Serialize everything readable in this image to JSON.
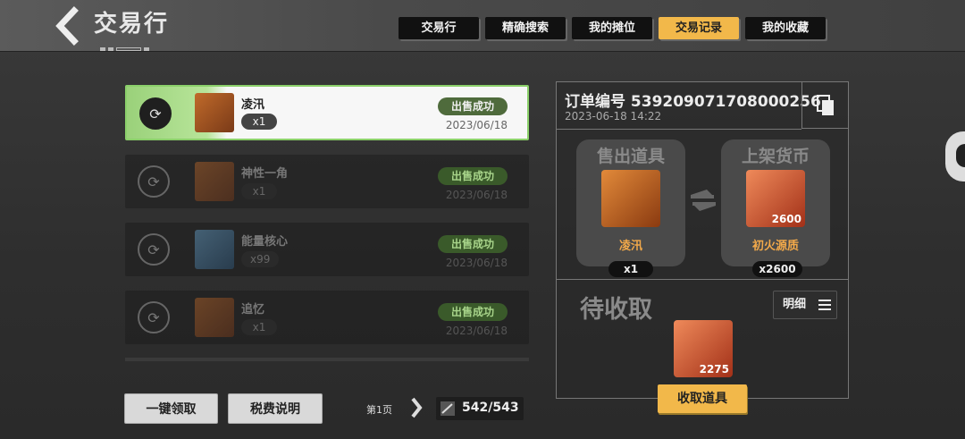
{
  "header": {
    "title": "交易行",
    "back_icon": "chevron-left-icon"
  },
  "tabs": [
    {
      "label": "交易行",
      "active": false
    },
    {
      "label": "精确搜索",
      "active": false
    },
    {
      "label": "我的摊位",
      "active": false
    },
    {
      "label": "交易记录",
      "active": true
    },
    {
      "label": "我的收藏",
      "active": false
    }
  ],
  "records": [
    {
      "name": "凌汛",
      "qty": "x1",
      "status": "出售成功",
      "date": "2023/06/18",
      "selected": true
    },
    {
      "name": "神性一角",
      "qty": "x1",
      "status": "出售成功",
      "date": "2023/06/18",
      "selected": false
    },
    {
      "name": "能量核心",
      "qty": "x99",
      "status": "出售成功",
      "date": "2023/06/18",
      "selected": false
    },
    {
      "name": "追忆",
      "qty": "x1",
      "status": "出售成功",
      "date": "2023/06/18",
      "selected": false
    }
  ],
  "bottom": {
    "claim_all": "一键领取",
    "tax_info": "税费说明",
    "page": "第1页",
    "count": "542/543"
  },
  "detail": {
    "order_label": "订单编号 539209071708000256",
    "order_time": "2023-06-18 14:22",
    "sold_title": "售出道具",
    "sold_name": "凌汛",
    "sold_qty": "x1",
    "listed_title": "上架货币",
    "listed_name": "初火源质",
    "listed_inner_qty": "2600",
    "listed_qty": "x2600",
    "pending_title": "待收取",
    "detail_btn": "明细",
    "pending_qty": "2275",
    "claim_btn": "收取道具"
  },
  "colors": {
    "accent": "#f2b84a",
    "success_green": "#8bd06a",
    "item_orange": "#f2a94a"
  }
}
